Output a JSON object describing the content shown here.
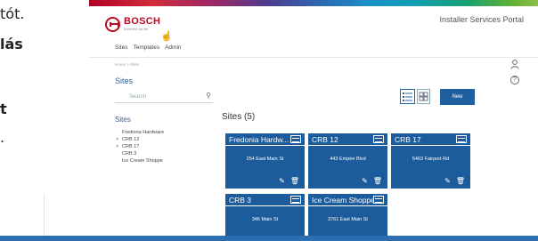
{
  "background_fragment": {
    "line1": "tót.",
    "line2": "lás",
    "line3": "t",
    "line4": "."
  },
  "header": {
    "logo_word": "BOSCH",
    "logo_tagline": "Invented for life",
    "portal_title": "Installer Services Portal"
  },
  "nav": {
    "items": [
      "Sites",
      "Templates",
      "Admin"
    ]
  },
  "breadcrumb": "Home  >  Sites",
  "page": {
    "title": "Sites",
    "search_placeholder": "Search",
    "new_button": "New",
    "help": "?"
  },
  "sidebar": {
    "heading": "Sites",
    "items": [
      {
        "label": "Fredonia Hardware",
        "expandable": false
      },
      {
        "label": "CRB 12",
        "expandable": true
      },
      {
        "label": "CRB 17",
        "expandable": true
      },
      {
        "label": "CRB 3",
        "expandable": false
      },
      {
        "label": "Ice Cream Shoppe",
        "expandable": false
      }
    ]
  },
  "grid": {
    "count_label": "Sites (5)",
    "cards": [
      {
        "name": "Fredonia Hardw...",
        "address": "254 East Main St",
        "actions": [
          "edit",
          "delete"
        ]
      },
      {
        "name": "CRB 12",
        "address": "443 Empire Blvd",
        "actions": [
          "edit",
          "delete"
        ]
      },
      {
        "name": "CRB 17",
        "address": "5463 Fairport Rd",
        "actions": [
          "edit",
          "delete"
        ]
      },
      {
        "name": "CRB 3",
        "address": "346 Main St",
        "actions": []
      },
      {
        "name": "Ice Cream Shoppe",
        "address": "3761 East Main St",
        "actions": []
      }
    ]
  },
  "colors": {
    "accent": "#1e5fa0",
    "card": "#1c5c9c",
    "brand_red": "#b90c23",
    "link_blue": "#2f5f9c"
  }
}
